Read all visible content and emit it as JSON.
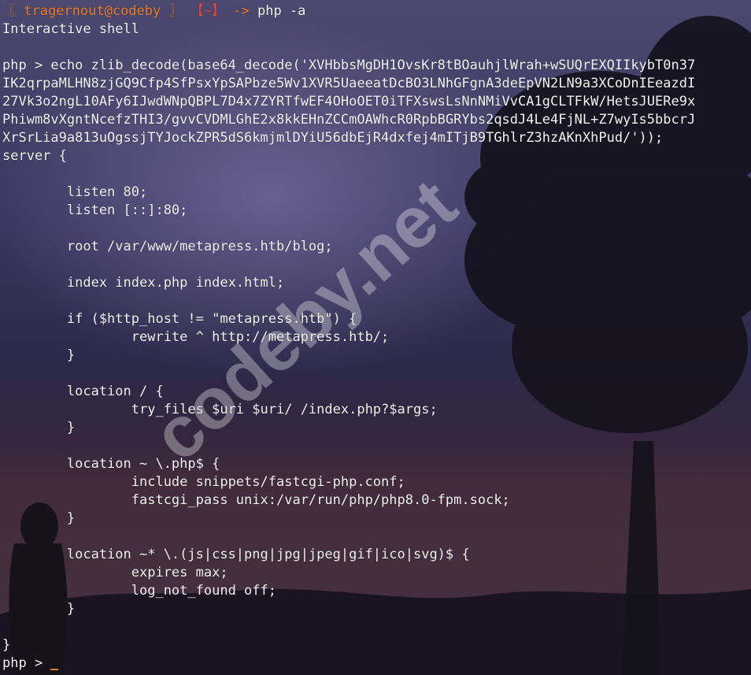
{
  "colors": {
    "prompt_user": "#e87f2a",
    "prompt_dir": "#e34b3c",
    "text": "#f2f2f2",
    "cursor": "#e87f2a"
  },
  "terminal": {
    "prompt": {
      "bracket_open": "〖",
      "user_host": "tragernout@codeby",
      "bracket_close": "〗",
      "dir": "【~】",
      "arrow": "->",
      "command": "php -a"
    },
    "lines": [
      "Interactive shell",
      "",
      "php > echo zlib_decode(base64_decode('XVHbbsMgDH1OvsKr8tBOauhjlWrah+wSUQrEXQIIkybT0n37",
      "IK2qrpaMLHN8zjGQ9Cfp4SfPsxYpSAPbze5Wv1XVR5UaeeatDcBO3LNhGFgnA3deEpVN2LN9a3XCoDnIEeazdI",
      "27Vk3o2ngL10AFy6IJwdWNpQBPL7D4x7ZYRTfwEF4OHoOET0iTFXswsLsNnNMiVvCA1gCLTFkW/HetsJUERe9x",
      "Phiwm8vXgntNcefzTHI3/gvvCVDMLGhE2x8kkEHnZCCmOAWhcR0RpbBGRYbs2qsdJ4Le4FjNL+Z7wyIs5bbcrJ",
      "XrSrLia9a813uOgssjTYJockZPR5dS6kmjmlDYiU56dbEjR4dxfej4mITjB9TGhlrZ3hzAKnXhPud/'));",
      "server {",
      "",
      "        listen 80;",
      "        listen [::]:80;",
      "",
      "        root /var/www/metapress.htb/blog;",
      "",
      "        index index.php index.html;",
      "",
      "        if ($http_host != \"metapress.htb\") {",
      "                rewrite ^ http://metapress.htb/;",
      "        }",
      "",
      "        location / {",
      "                try_files $uri $uri/ /index.php?$args;",
      "        }",
      "",
      "        location ~ \\.php$ {",
      "                include snippets/fastcgi-php.conf;",
      "                fastcgi_pass unix:/var/run/php/php8.0-fpm.sock;",
      "        }",
      "",
      "        location ~* \\.(js|css|png|jpg|jpeg|gif|ico|svg)$ {",
      "                expires max;",
      "                log_not_found off;",
      "        }",
      "",
      "}"
    ],
    "final_prompt": "php > "
  },
  "watermark": "codeby.net"
}
